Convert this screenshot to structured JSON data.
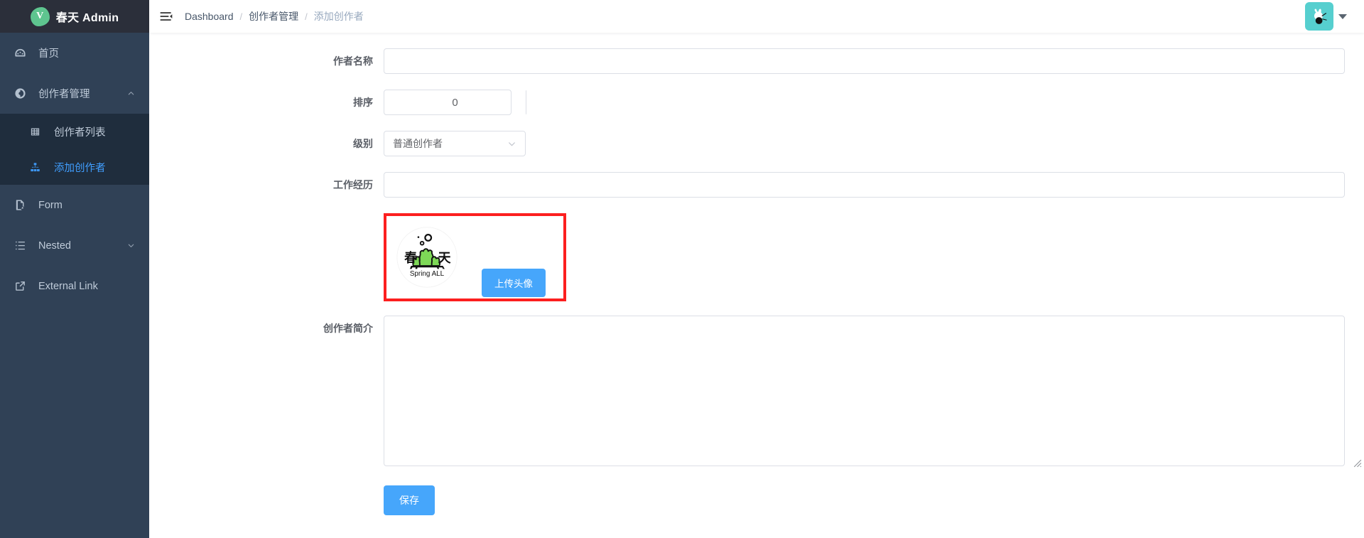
{
  "brand": {
    "logo_letter": "V",
    "title": "春天 Admin",
    "logo_color": "#5ec58f"
  },
  "sidebar": {
    "items": [
      {
        "label": "首页",
        "icon": "dashboard-icon",
        "active": false
      },
      {
        "label": "创作者管理",
        "icon": "component-icon",
        "active": false,
        "expanded": true
      },
      {
        "label": "Form",
        "icon": "form-icon",
        "active": false
      },
      {
        "label": "Nested",
        "icon": "nested-list-icon",
        "active": false
      },
      {
        "label": "External Link",
        "icon": "external-link-icon",
        "active": false
      }
    ],
    "submenu": [
      {
        "label": "创作者列表",
        "icon": "table-icon",
        "active": false
      },
      {
        "label": "添加创作者",
        "icon": "tree-icon",
        "active": true
      }
    ],
    "active_color": "#409eff",
    "background": "#304156",
    "submenu_background": "#1f2d3d"
  },
  "navbar": {
    "hamburger": "hamburger-icon",
    "breadcrumb": [
      {
        "label": "Dashboard",
        "current": false
      },
      {
        "label": "创作者管理",
        "current": false
      },
      {
        "label": "添加创作者",
        "current": true
      }
    ],
    "separator": "/",
    "avatar": "user-avatar",
    "avatar_color": "#56cfcf"
  },
  "form": {
    "fields": {
      "author_name": {
        "label": "作者名称",
        "value": "",
        "placeholder": ""
      },
      "sort_order": {
        "label": "排序",
        "value": "0"
      },
      "level": {
        "label": "级别",
        "value": "普通创作者"
      },
      "work_experience": {
        "label": "工作经历",
        "value": "",
        "placeholder": ""
      },
      "intro": {
        "label": "创作者简介",
        "value": "",
        "placeholder": ""
      }
    },
    "upload": {
      "button_label": "上传头像",
      "highlight_color": "#fc1f1f",
      "avatar_caption": "Spring ALL",
      "avatar_left_char": "春",
      "avatar_right_char": "天"
    },
    "save_button": "保存",
    "primary_color": "#46a6fb"
  }
}
